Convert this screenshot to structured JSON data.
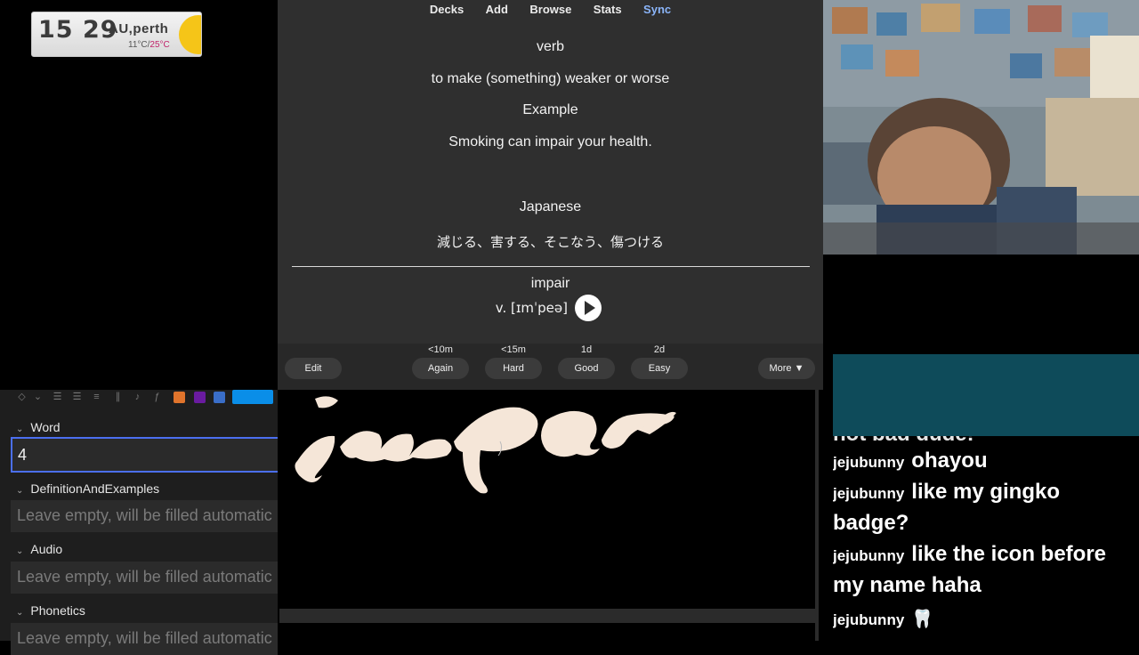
{
  "weather": {
    "time": "15 29",
    "city": "AU,perth",
    "temp_low": "11°C/",
    "temp_high": "25°C"
  },
  "menu": {
    "items": [
      "Decks",
      "Add",
      "Browse",
      "Stats",
      "Sync"
    ]
  },
  "card": {
    "part_of_speech": "verb",
    "definition": "to make (something) weaker or worse",
    "example_heading": "Example",
    "example": "Smoking can impair your health.",
    "japanese_heading": "Japanese",
    "japanese": "減じる、害する、そこなう、傷つける",
    "word": "impair",
    "phonetic": "v. [ɪmˈpeə]"
  },
  "answer_bar": {
    "edit": "Edit",
    "more": "More ▼",
    "buttons": [
      {
        "label": "Again",
        "due": "<10m"
      },
      {
        "label": "Hard",
        "due": "<15m"
      },
      {
        "label": "Good",
        "due": "1d"
      },
      {
        "label": "Easy",
        "due": "2d"
      }
    ]
  },
  "editor": {
    "fields": [
      {
        "label": "Word",
        "value": "4"
      },
      {
        "label": "DefinitionAndExamples",
        "placeholder": "Leave empty, will be filled automatic"
      },
      {
        "label": "Audio",
        "placeholder": "Leave empty, will be filled automatic"
      },
      {
        "label": "Phonetics",
        "placeholder": "Leave empty, will be filled automatic"
      }
    ]
  },
  "chat": {
    "partial_top": "not bad dude!",
    "messages": [
      {
        "user": "jejubunny",
        "text": "ohayou"
      },
      {
        "user": "jejubunny",
        "text": "like my gingko"
      },
      {
        "user": "",
        "text": "badge?"
      },
      {
        "user": "jejubunny",
        "text": "like the icon before"
      },
      {
        "user": "",
        "text": "my name haha"
      },
      {
        "user": "jejubunny",
        "text": "🦷"
      }
    ]
  },
  "colors": {
    "sync_accent": "#8ab4f8",
    "field_focus": "#4b6ff0",
    "ink": "#f5e6d8",
    "chat_overlay": "#0e4b5a"
  }
}
